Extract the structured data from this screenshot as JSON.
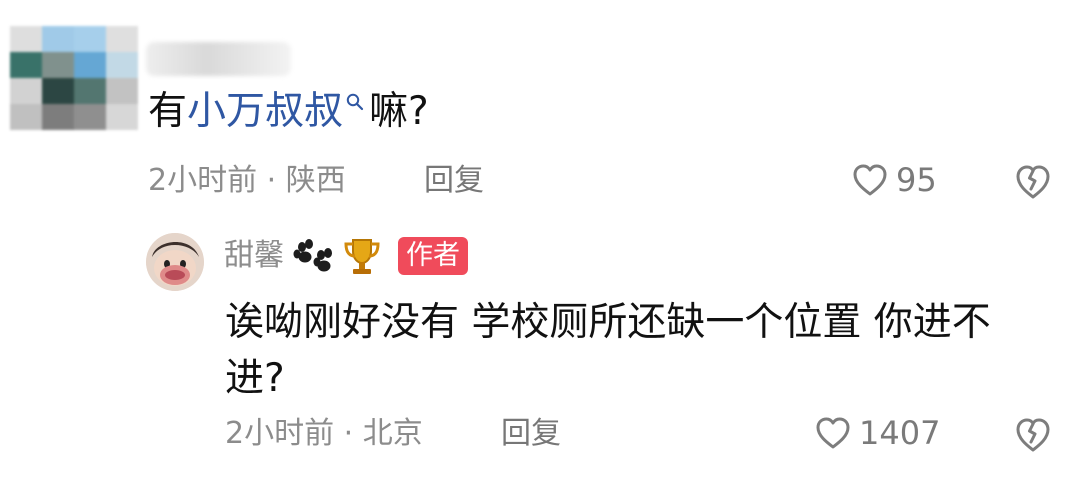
{
  "comment": {
    "text_prefix": "有",
    "search_link_text": "小万叔叔",
    "text_suffix": "嘛?",
    "time_location": "2小时前 · 陕西",
    "reply_label": "回复",
    "like_count": "95"
  },
  "reply": {
    "author_name": "甜馨",
    "author_badge": "作者",
    "text": "诶呦刚好没有 学校厕所还缺一个位置 你进不进?",
    "time_location": "2小时前 · 北京",
    "reply_label": "回复",
    "like_count": "1407"
  },
  "icons": {
    "search": "search-icon",
    "heart": "heart-icon",
    "broken_heart": "broken-heart-icon",
    "paw": "paw-icon",
    "trophy": "trophy-icon"
  },
  "colors": {
    "link": "#2f57a3",
    "meta": "#8c8c8c",
    "badge": "#f04b5b",
    "trophy": "#d99a10"
  }
}
